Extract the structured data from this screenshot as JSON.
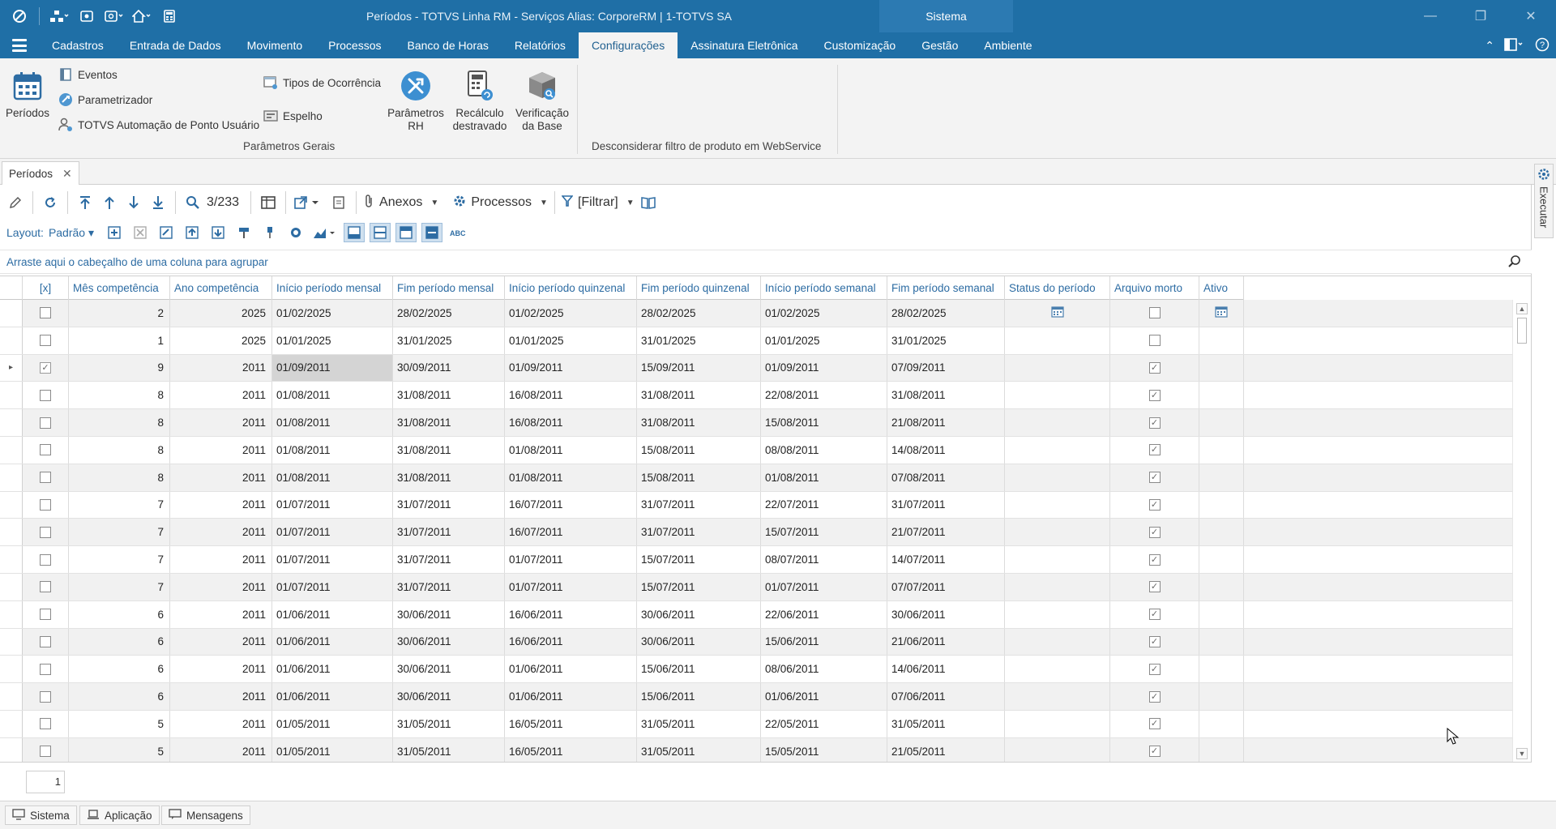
{
  "window": {
    "title": "Períodos - TOTVS Linha RM - Serviços  Alias: CorporeRM | 1-TOTVS SA",
    "context_tab": "Sistema"
  },
  "menu": {
    "tabs": [
      "Cadastros",
      "Entrada de Dados",
      "Movimento",
      "Processos",
      "Banco de Horas",
      "Relatórios",
      "Configurações",
      "Assinatura Eletrônica",
      "Customização",
      "Gestão",
      "Ambiente"
    ],
    "active_tab": "Configurações"
  },
  "ribbon": {
    "periodos": "Períodos",
    "eventos": "Eventos",
    "parametrizador": "Parametrizador",
    "automacao": "TOTVS Automação de Ponto Usuário",
    "tipos_ocorrencia": "Tipos de Ocorrência",
    "espelho": "Espelho",
    "parametros_rh_l1": "Parâmetros",
    "parametros_rh_l2": "RH",
    "recalculo_l1": "Recálculo",
    "recalculo_l2": "destravado",
    "verificacao_l1": "Verificação",
    "verificacao_l2": "da Base",
    "group_parametros_gerais": "Parâmetros Gerais",
    "group_webservice": "Desconsiderar filtro de produto em WebService"
  },
  "doc_tab": {
    "label": "Períodos"
  },
  "toolbar": {
    "record_position": "3/233",
    "anexos": "Anexos",
    "processos": "Processos",
    "filtrar": "[Filtrar]",
    "layout_label": "Layout:",
    "layout_value": "Padrão"
  },
  "group_hint": "Arraste aqui o cabeçalho de uma coluna para agrupar",
  "grid": {
    "columns": [
      "[x]",
      "Mês competência",
      "Ano competência",
      "Início período mensal",
      "Fim período mensal",
      "Início período quinzenal",
      "Fim período quinzenal",
      "Início período semanal",
      "Fim período semanal",
      "Status do período",
      "Arquivo morto",
      "Ativo"
    ],
    "rows": [
      {
        "sel": false,
        "mes": "2",
        "ano": "2025",
        "ini_m": "01/02/2025",
        "fim_m": "28/02/2025",
        "ini_q": "01/02/2025",
        "fim_q": "28/02/2025",
        "ini_s": "01/02/2025",
        "fim_s": "28/02/2025",
        "status_icon": true,
        "arquivo": false,
        "ativo_icon": true,
        "current": false
      },
      {
        "sel": false,
        "mes": "1",
        "ano": "2025",
        "ini_m": "01/01/2025",
        "fim_m": "31/01/2025",
        "ini_q": "01/01/2025",
        "fim_q": "31/01/2025",
        "ini_s": "01/01/2025",
        "fim_s": "31/01/2025",
        "status_icon": false,
        "arquivo": false,
        "ativo_icon": false,
        "current": false
      },
      {
        "sel": true,
        "mes": "9",
        "ano": "2011",
        "ini_m": "01/09/2011",
        "fim_m": "30/09/2011",
        "ini_q": "01/09/2011",
        "fim_q": "15/09/2011",
        "ini_s": "01/09/2011",
        "fim_s": "07/09/2011",
        "status_icon": false,
        "arquivo": true,
        "ativo_icon": false,
        "current": true
      },
      {
        "sel": false,
        "mes": "8",
        "ano": "2011",
        "ini_m": "01/08/2011",
        "fim_m": "31/08/2011",
        "ini_q": "16/08/2011",
        "fim_q": "31/08/2011",
        "ini_s": "22/08/2011",
        "fim_s": "31/08/2011",
        "status_icon": false,
        "arquivo": true,
        "ativo_icon": false,
        "current": false
      },
      {
        "sel": false,
        "mes": "8",
        "ano": "2011",
        "ini_m": "01/08/2011",
        "fim_m": "31/08/2011",
        "ini_q": "16/08/2011",
        "fim_q": "31/08/2011",
        "ini_s": "15/08/2011",
        "fim_s": "21/08/2011",
        "status_icon": false,
        "arquivo": true,
        "ativo_icon": false,
        "current": false
      },
      {
        "sel": false,
        "mes": "8",
        "ano": "2011",
        "ini_m": "01/08/2011",
        "fim_m": "31/08/2011",
        "ini_q": "01/08/2011",
        "fim_q": "15/08/2011",
        "ini_s": "08/08/2011",
        "fim_s": "14/08/2011",
        "status_icon": false,
        "arquivo": true,
        "ativo_icon": false,
        "current": false
      },
      {
        "sel": false,
        "mes": "8",
        "ano": "2011",
        "ini_m": "01/08/2011",
        "fim_m": "31/08/2011",
        "ini_q": "01/08/2011",
        "fim_q": "15/08/2011",
        "ini_s": "01/08/2011",
        "fim_s": "07/08/2011",
        "status_icon": false,
        "arquivo": true,
        "ativo_icon": false,
        "current": false
      },
      {
        "sel": false,
        "mes": "7",
        "ano": "2011",
        "ini_m": "01/07/2011",
        "fim_m": "31/07/2011",
        "ini_q": "16/07/2011",
        "fim_q": "31/07/2011",
        "ini_s": "22/07/2011",
        "fim_s": "31/07/2011",
        "status_icon": false,
        "arquivo": true,
        "ativo_icon": false,
        "current": false
      },
      {
        "sel": false,
        "mes": "7",
        "ano": "2011",
        "ini_m": "01/07/2011",
        "fim_m": "31/07/2011",
        "ini_q": "16/07/2011",
        "fim_q": "31/07/2011",
        "ini_s": "15/07/2011",
        "fim_s": "21/07/2011",
        "status_icon": false,
        "arquivo": true,
        "ativo_icon": false,
        "current": false
      },
      {
        "sel": false,
        "mes": "7",
        "ano": "2011",
        "ini_m": "01/07/2011",
        "fim_m": "31/07/2011",
        "ini_q": "01/07/2011",
        "fim_q": "15/07/2011",
        "ini_s": "08/07/2011",
        "fim_s": "14/07/2011",
        "status_icon": false,
        "arquivo": true,
        "ativo_icon": false,
        "current": false
      },
      {
        "sel": false,
        "mes": "7",
        "ano": "2011",
        "ini_m": "01/07/2011",
        "fim_m": "31/07/2011",
        "ini_q": "01/07/2011",
        "fim_q": "15/07/2011",
        "ini_s": "01/07/2011",
        "fim_s": "07/07/2011",
        "status_icon": false,
        "arquivo": true,
        "ativo_icon": false,
        "current": false
      },
      {
        "sel": false,
        "mes": "6",
        "ano": "2011",
        "ini_m": "01/06/2011",
        "fim_m": "30/06/2011",
        "ini_q": "16/06/2011",
        "fim_q": "30/06/2011",
        "ini_s": "22/06/2011",
        "fim_s": "30/06/2011",
        "status_icon": false,
        "arquivo": true,
        "ativo_icon": false,
        "current": false
      },
      {
        "sel": false,
        "mes": "6",
        "ano": "2011",
        "ini_m": "01/06/2011",
        "fim_m": "30/06/2011",
        "ini_q": "16/06/2011",
        "fim_q": "30/06/2011",
        "ini_s": "15/06/2011",
        "fim_s": "21/06/2011",
        "status_icon": false,
        "arquivo": true,
        "ativo_icon": false,
        "current": false
      },
      {
        "sel": false,
        "mes": "6",
        "ano": "2011",
        "ini_m": "01/06/2011",
        "fim_m": "30/06/2011",
        "ini_q": "01/06/2011",
        "fim_q": "15/06/2011",
        "ini_s": "08/06/2011",
        "fim_s": "14/06/2011",
        "status_icon": false,
        "arquivo": true,
        "ativo_icon": false,
        "current": false
      },
      {
        "sel": false,
        "mes": "6",
        "ano": "2011",
        "ini_m": "01/06/2011",
        "fim_m": "30/06/2011",
        "ini_q": "01/06/2011",
        "fim_q": "15/06/2011",
        "ini_s": "01/06/2011",
        "fim_s": "07/06/2011",
        "status_icon": false,
        "arquivo": true,
        "ativo_icon": false,
        "current": false
      },
      {
        "sel": false,
        "mes": "5",
        "ano": "2011",
        "ini_m": "01/05/2011",
        "fim_m": "31/05/2011",
        "ini_q": "16/05/2011",
        "fim_q": "31/05/2011",
        "ini_s": "22/05/2011",
        "fim_s": "31/05/2011",
        "status_icon": false,
        "arquivo": true,
        "ativo_icon": false,
        "current": false
      },
      {
        "sel": false,
        "mes": "5",
        "ano": "2011",
        "ini_m": "01/05/2011",
        "fim_m": "31/05/2011",
        "ini_q": "16/05/2011",
        "fim_q": "31/05/2011",
        "ini_s": "15/05/2011",
        "fim_s": "21/05/2011",
        "status_icon": false,
        "arquivo": true,
        "ativo_icon": false,
        "current": false
      }
    ]
  },
  "pager": {
    "page": "1"
  },
  "side_panel": {
    "executar": "Executar"
  },
  "statusbar": {
    "sistema": "Sistema",
    "aplicacao": "Aplicação",
    "mensagens": "Mensagens"
  },
  "colors": {
    "titlebar": "#1f6fa6",
    "accent": "#2d6ca3",
    "ribbon_bg": "#f3f3f3"
  }
}
